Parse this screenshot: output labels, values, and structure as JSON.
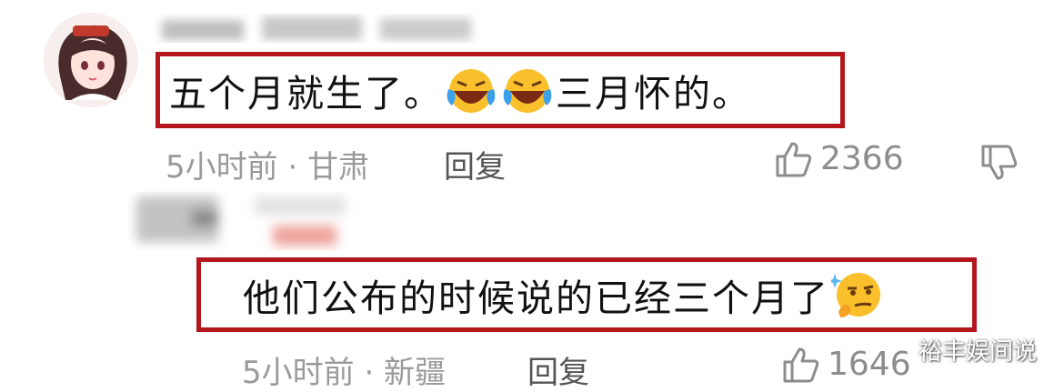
{
  "comments": [
    {
      "text_before": "五个月就生了。",
      "emojis": [
        "laughing-crying-emoji",
        "laughing-crying-emoji"
      ],
      "text_after": "三月怀的。",
      "meta": "5小时前 · 甘肃",
      "reply_label": "回复",
      "likes": "2366"
    },
    {
      "text_before": "他们公布的时候说的已经三个月了",
      "emojis": [
        "smirk-thinking-emoji"
      ],
      "text_after": "",
      "meta": "5小时前 · 新疆",
      "reply_label": "回复",
      "likes": "1646"
    }
  ],
  "watermark": "裕丰娱间说",
  "colors": {
    "highlight_border": "#b3171b",
    "meta_text": "#9a9a9a",
    "icon": "#8c8c8c"
  }
}
